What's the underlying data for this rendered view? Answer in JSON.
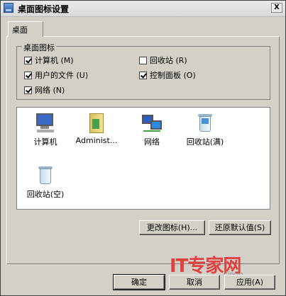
{
  "window": {
    "title": "桌面图标设置",
    "close_label": "X"
  },
  "tabs": [
    {
      "label": "桌面"
    }
  ],
  "group": {
    "legend": "桌面图标",
    "checkboxes": [
      {
        "label": "计算机 (M)",
        "checked": true
      },
      {
        "label": "回收站 (R)",
        "checked": false
      },
      {
        "label": "用户的文件 (U)",
        "checked": true
      },
      {
        "label": "控制面板 (O)",
        "checked": true
      },
      {
        "label": "网络 (N)",
        "checked": true
      }
    ]
  },
  "icons": [
    {
      "label": "计算机",
      "icon": "computer-icon"
    },
    {
      "label": "Administ...",
      "icon": "user-folder-icon"
    },
    {
      "label": "网络",
      "icon": "network-icon"
    },
    {
      "label": "回收站(满)",
      "icon": "recycle-bin-full-icon"
    },
    {
      "label": "回收站(空)",
      "icon": "recycle-bin-empty-icon"
    }
  ],
  "buttons": {
    "change_icon": "更改图标(H)...",
    "restore_default": "还原默认值(S)",
    "ok": "确定",
    "cancel": "取消",
    "apply": "应用(A)"
  },
  "watermark": {
    "text": "IT专家网",
    "sub": "Ciocio"
  }
}
